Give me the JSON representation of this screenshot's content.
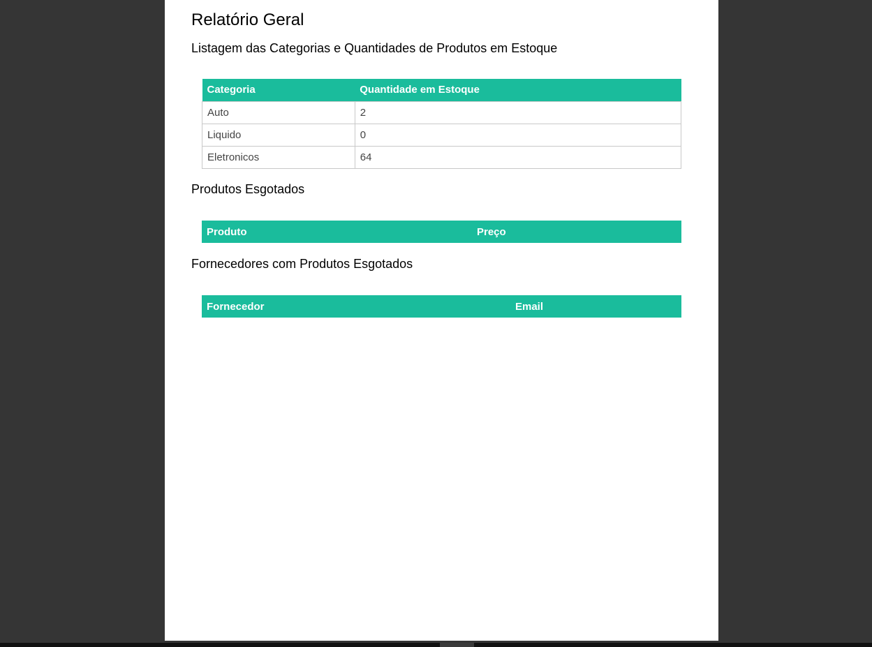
{
  "report": {
    "title": "Relatório Geral",
    "categories_section": {
      "heading": "Listagem das Categorias e Quantidades de Produtos em Estoque",
      "columns": [
        "Categoria",
        "Quantidade em Estoque"
      ],
      "rows": [
        {
          "categoria": "Auto",
          "quantidade": "2"
        },
        {
          "categoria": "Liquido",
          "quantidade": "0"
        },
        {
          "categoria": "Eletronicos",
          "quantidade": "64"
        }
      ]
    },
    "sold_out_section": {
      "heading": "Produtos Esgotados",
      "columns": [
        "Produto",
        "Preço"
      ],
      "rows": []
    },
    "suppliers_section": {
      "heading": "Fornecedores com Produtos Esgotados",
      "columns": [
        "Fornecedor",
        "Email"
      ],
      "rows": []
    }
  },
  "colors": {
    "header_bg": "#1abc9c",
    "viewer_bg": "#353535",
    "page_bg": "#ffffff"
  }
}
